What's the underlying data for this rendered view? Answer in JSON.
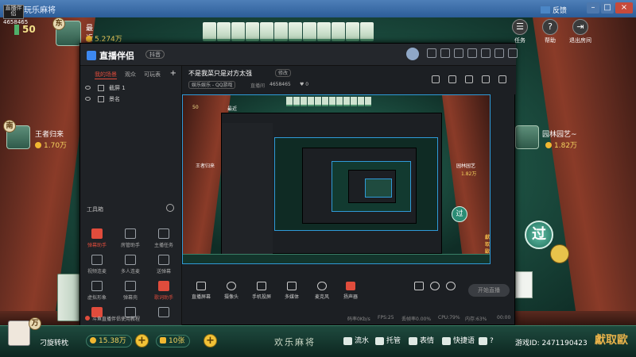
{
  "window": {
    "title": "玩乐麻将"
  },
  "top_left": {
    "logo_text": "直播伴侣",
    "id": "4658465",
    "score": "50"
  },
  "players": {
    "top": {
      "name": "最近",
      "coins": "5.274万",
      "seat": "东"
    },
    "left": {
      "name": "王者归来",
      "coins": "1.70万",
      "seat": "南"
    },
    "right": {
      "name": "园林园艺~",
      "coins": "1.82万"
    },
    "self": {
      "name": "刁旋转枕",
      "coins": "15.38万",
      "seat": "万",
      "cards": "10张"
    }
  },
  "top_right": {
    "feedback": "反馈",
    "task": "任务",
    "help": "帮助",
    "exit": "退出房间"
  },
  "game_actions": {
    "pass": "过"
  },
  "bottom_bar": {
    "logo": "欢乐麻将",
    "btn_flow": "流水",
    "btn_hosting": "托管",
    "btn_emoji": "表情",
    "btn_quicktalk": "快捷语",
    "btn_question": "?",
    "game_id_label": "游戏ID:",
    "game_id": "2471190423",
    "watermark": "獻取歐"
  },
  "live_app": {
    "logo": "直播伴侣",
    "tag": "抖音",
    "tabs": [
      "我的场景",
      "观众",
      "可玩表"
    ],
    "scenes": [
      "截屏 1",
      "景名"
    ],
    "tools_title": "工具箱",
    "tools": [
      {
        "label": "弹幕助手",
        "hot": true
      },
      {
        "label": "房管助手",
        "hot": false
      },
      {
        "label": "主播任务",
        "hot": false
      },
      {
        "label": "视频连麦",
        "hot": false
      },
      {
        "label": "多人连麦",
        "hot": false
      },
      {
        "label": "送弹幕",
        "hot": false
      },
      {
        "label": "虚拟形象",
        "hot": false
      },
      {
        "label": "弹幕壳",
        "hot": false
      },
      {
        "label": "歌词助手",
        "hot": true
      },
      {
        "label": "",
        "hot": true
      },
      {
        "label": "",
        "hot": false
      },
      {
        "label": "",
        "hot": false
      }
    ],
    "help_link": "斗鱼直播伴侣使用教程",
    "room_title": "不是我菜只是对方太强",
    "edit": "修改",
    "category": "娱乐娱乐 - QQ游戏",
    "follow": "直播间",
    "room_id": "4658465",
    "likes": "0",
    "actions": [
      "直播屏幕",
      "摄像头",
      "手机投屏",
      "多媒体",
      "麦克风",
      "扬声器"
    ],
    "start_button": "开始直播",
    "status": {
      "bitrate": "码率0Kb/s",
      "fps": "FPS:25",
      "loss": "丢帧率0.00%",
      "cpu": "CPU:79%",
      "mem": "内存:63%",
      "time": "00:00"
    }
  },
  "nested": {
    "score": "50",
    "top_name": "最近",
    "left_name": "王者归来",
    "right_name": "园林园艺",
    "right_coins": "1.82万",
    "pass": "过",
    "watermark": "獻取歐"
  }
}
